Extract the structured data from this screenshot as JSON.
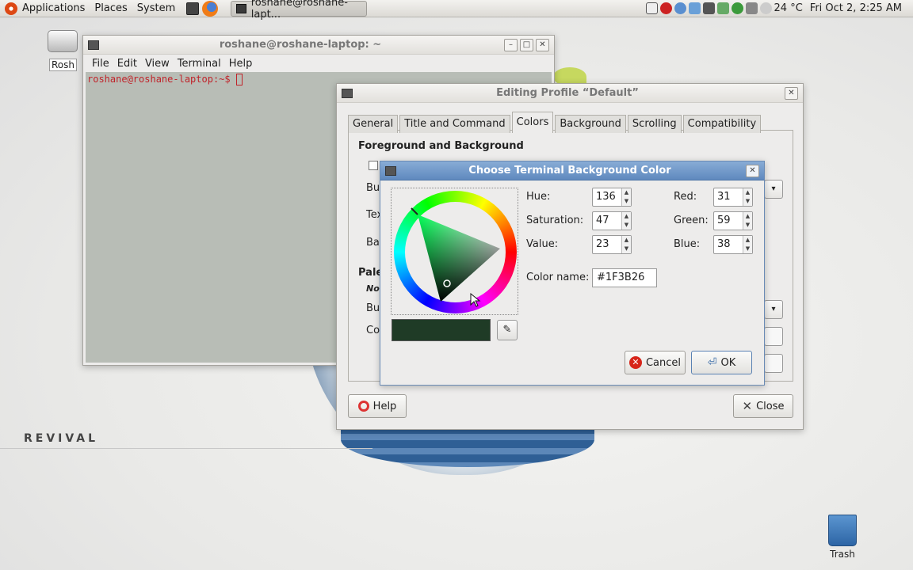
{
  "top_panel": {
    "menus": [
      "Applications",
      "Places",
      "System"
    ],
    "taskbar_item": "roshane@roshane-lapt...",
    "weather": "24 °C",
    "clock": "Fri Oct  2,  2:25 AM"
  },
  "desktop": {
    "home_label": "Rosh",
    "revival_logo": "REVIVAL",
    "trash_label": "Trash"
  },
  "terminal": {
    "title": "roshane@roshane-laptop: ~",
    "menus": [
      "File",
      "Edit",
      "View",
      "Terminal",
      "Help"
    ],
    "prompt": "roshane@roshane-laptop:~$"
  },
  "profile": {
    "title": "Editing Profile “Default”",
    "tabs": [
      "General",
      "Title and Command",
      "Colors",
      "Background",
      "Scrolling",
      "Compatibility"
    ],
    "active_tab": "Colors",
    "section_fg_bg": "Foreground and Background",
    "frag_bui": "Bui",
    "frag_tex": "Tex",
    "frag_bac": "Bac",
    "frag_pale": "Pale",
    "frag_no": "No",
    "frag_bui2": "Bui",
    "frag_col": "Col",
    "help_button": "Help",
    "close_button": "Close"
  },
  "chooser": {
    "title": "Choose Terminal Background Color",
    "hue_label": "Hue:",
    "hue": "136",
    "saturation_label": "Saturation:",
    "saturation": "47",
    "value_label": "Value:",
    "value": "23",
    "red_label": "Red:",
    "red": "31",
    "green_label": "Green:",
    "green": "59",
    "blue_label": "Blue:",
    "blue": "38",
    "color_name_label": "Color name:",
    "color_name": "#1F3B26",
    "cancel_button": "Cancel",
    "ok_button": "OK"
  },
  "colors": {
    "selected_color": "#1F3B26",
    "terminal_background": "#B8BDB6",
    "prompt": "#C0232A"
  }
}
